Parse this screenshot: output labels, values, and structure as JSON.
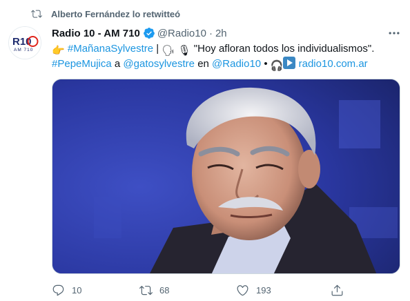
{
  "retweet": {
    "text": "Alberto Fernández lo retwitteó",
    "icon": "retweet-icon"
  },
  "author": {
    "display_name": "Radio 10 - AM 710",
    "handle": "@Radio10",
    "separator": "·",
    "time": "2h",
    "avatar_text": "R10",
    "avatar_subtext": "AM 710",
    "verified_icon": "verified-badge-icon"
  },
  "tweet": {
    "line1": {
      "emoji_pointing": "👉",
      "hashtag1": "#MañanaSylvestre",
      "separator": "|",
      "emoji_speaking": "🗣",
      "emoji_mic": "🎙",
      "quote": "\"Hoy afloran todos los individualismos\"."
    },
    "line2": {
      "hashtag2": "#PepeMujica",
      "word_a": "a",
      "mention1": "@gatosylvestre",
      "word_en": "en",
      "mention2": "@Radio10",
      "bullet": "•",
      "emoji_headphones": "🎧",
      "emoji_play": "▶",
      "link": "radio10.com.ar"
    }
  },
  "media": {
    "description_icon": "photo-portrait"
  },
  "actions": {
    "reply_count": "10",
    "retweet_count": "68",
    "like_count": "193"
  },
  "colors": {
    "link": "#1b95e0",
    "secondary_text": "#536471",
    "verified": "#1d9bf0",
    "photo_background": "#2b3aa0"
  }
}
